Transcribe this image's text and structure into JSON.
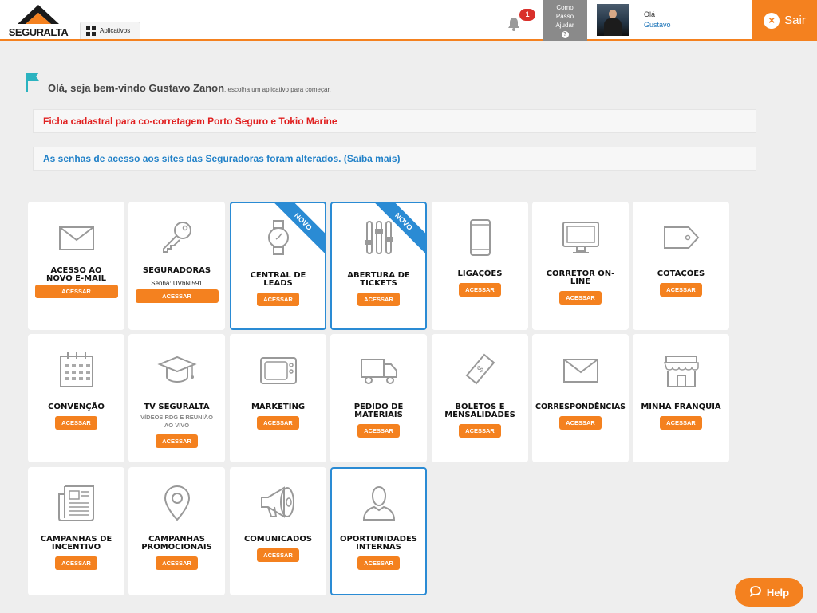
{
  "header": {
    "logo_text": "SEGURALTA",
    "apps_label": "Aplicativos",
    "notification_count": "1",
    "help_line1": "Como",
    "help_line2": "Passo",
    "help_line3": "Ajudar",
    "help_q": "?",
    "greeting": "Olá",
    "user_name": "Gustavo",
    "logout_label": "Sair",
    "logout_icon": "×"
  },
  "welcome": {
    "main": "Olá, seja bem-vindo Gustavo Zanon",
    "sub": ", escolha um aplicativo para começar."
  },
  "notices": [
    {
      "text": "Ficha cadastral para co-corretagem Porto Seguro e Tokio Marine"
    },
    {
      "text": "As senhas de acesso aos sites das Seguradoras foram alterados. (Saiba mais)"
    }
  ],
  "tiles": [
    {
      "title": "Acesso ao novo e-mail",
      "button": "ACESSAR",
      "icon": "mail-icon"
    },
    {
      "title": "Seguradoras",
      "sub": "Senha: UVbNI591",
      "button": "ACESSAR",
      "icon": "key-icon"
    },
    {
      "title": "Central de leads",
      "button": "ACESSAR",
      "icon": "watch-icon",
      "ribbon": "NOVO"
    },
    {
      "title": "Abertura de tickets",
      "button": "ACESSAR",
      "icon": "sliders-icon",
      "ribbon": "NOVO"
    },
    {
      "title": "Ligações",
      "button": "ACESSAR",
      "icon": "phone-icon"
    },
    {
      "title": "Corretor on-line",
      "button": "ACESSAR",
      "icon": "monitor-icon"
    },
    {
      "title": "Cotações",
      "button": "ACESSAR",
      "icon": "tag-icon"
    },
    {
      "title": "Convenção",
      "button": "ACESSAR",
      "icon": "calendar-icon"
    },
    {
      "title": "TV Seguralta",
      "sub2": "Vídeos RDG e reunião ao vivo",
      "button": "ACESSAR",
      "icon": "graduation-cap-icon"
    },
    {
      "title": "Marketing",
      "button": "ACESSAR",
      "icon": "tv-icon"
    },
    {
      "title": "Pedido de materiais",
      "button": "ACESSAR",
      "icon": "truck-icon"
    },
    {
      "title": "Boletos e mensalidades",
      "button": "ACESSAR",
      "icon": "money-icon"
    },
    {
      "title": "Correspondências",
      "button": "ACESSAR",
      "icon": "envelope-icon"
    },
    {
      "title": "Minha franquia",
      "button": "ACESSAR",
      "icon": "store-icon"
    },
    {
      "title": "Campanhas de incentivo",
      "button": "ACESSAR",
      "icon": "newspaper-icon"
    },
    {
      "title": "Campanhas promocionais",
      "button": "ACESSAR",
      "icon": "map-pin-icon"
    },
    {
      "title": "Comunicados",
      "button": "ACESSAR",
      "icon": "megaphone-icon"
    },
    {
      "title": "Oportunidades internas",
      "button": "ACESSAR",
      "icon": "user-icon"
    }
  ],
  "help_button": "Help",
  "colors": {
    "accent": "#f4811f",
    "new_border": "#2a8bd4",
    "link_blue": "#2181c8",
    "alert_red": "#e02020"
  }
}
